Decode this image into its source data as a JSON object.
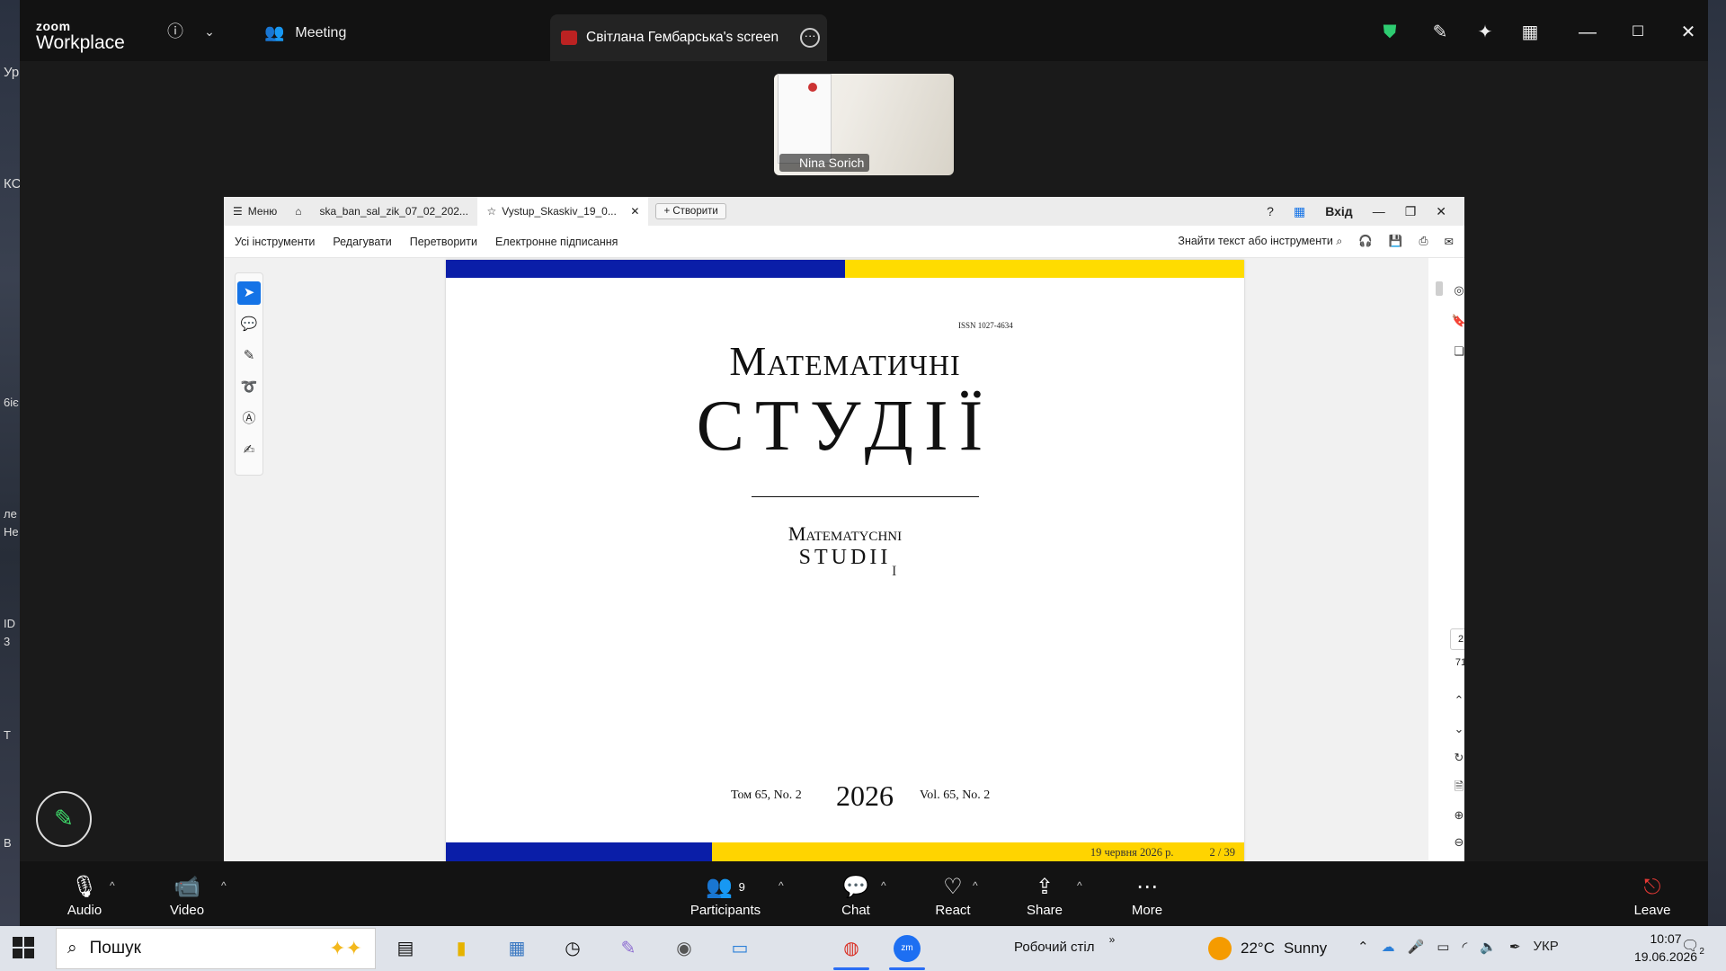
{
  "desktop": {
    "left_fragments": [
      "Ур",
      "КС",
      "6іє",
      "ле",
      "Не",
      "ID",
      "3",
      "Т",
      "В"
    ]
  },
  "zoom": {
    "logo_small": "zoom",
    "logo_big": "Workplace",
    "meeting_label": "Meeting",
    "screen_tab_label": "Світлана Гембарська's screen",
    "participant_name": "Nina Sorich",
    "controls": {
      "audio": "Audio",
      "video": "Video",
      "participants": "Participants",
      "participants_count": "9",
      "chat": "Chat",
      "react": "React",
      "share": "Share",
      "more": "More",
      "leave": "Leave"
    }
  },
  "pdf_viewer": {
    "menu": "Меню",
    "tab1": "ska_ban_sal_zik_07_02_202...",
    "tab2": "Vystup_Skaskiv_19_0...",
    "create": "Створити",
    "signin": "Вхід",
    "toolbar": {
      "all_tools": "Усі інструменти",
      "edit": "Редагувати",
      "convert": "Перетворити",
      "esign": "Електронне підписання",
      "find": "Знайти текст або інструменти"
    },
    "page_current": "2",
    "page_total": "71"
  },
  "document": {
    "issn": "ISSN 1027-4634",
    "title_line1": "Математичні",
    "title_line2": "СТУДІЇ",
    "latin_line1": "Matematychni",
    "latin_line2": "STUDII",
    "vol_ua": "Том 65, No. 2",
    "year": "2026",
    "vol_en": "Vol. 65, No. 2",
    "footer_date": "19 червня 2026 р.",
    "footer_page": "2 / 39"
  },
  "taskbar": {
    "search_placeholder": "Пошук",
    "desktop_label": "Робочий стіл",
    "weather_temp": "22°C",
    "weather_text": "Sunny",
    "language": "УКР",
    "time": "10:07",
    "date": "19.06.2026",
    "notifications": "2"
  }
}
